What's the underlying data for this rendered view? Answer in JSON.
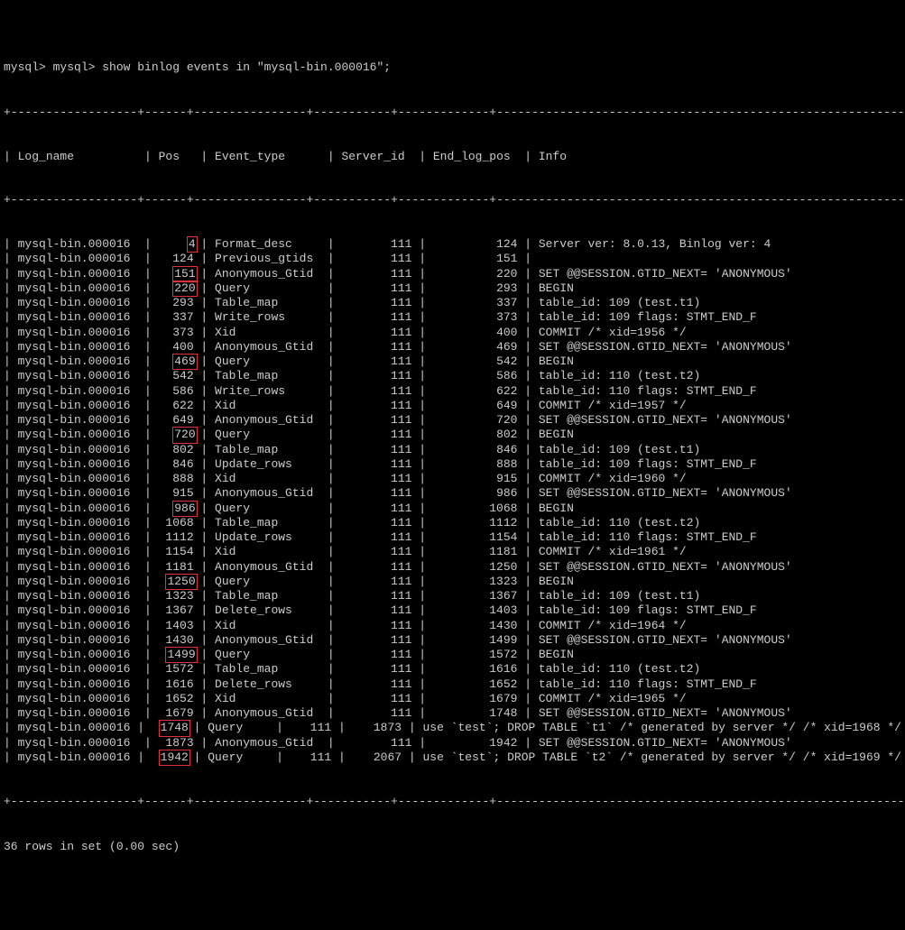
{
  "prompt": "mysql> mysql> show binlog events in \"mysql-bin.000016\";",
  "headers": {
    "log_name": "Log_name",
    "pos": "Pos",
    "event_type": "Event_type",
    "server_id": "Server_id",
    "end_log_pos": "End_log_pos",
    "info": "Info"
  },
  "border": "+------------------+------+----------------+-----------+-------------+----------------------------------------------------------------------+",
  "rows": [
    {
      "log": "mysql-bin.000016",
      "pos": "4",
      "hl": true,
      "ev": "Format_desc",
      "sid": "111",
      "end": "124",
      "info": "Server ver: 8.0.13, Binlog ver: 4"
    },
    {
      "log": "mysql-bin.000016",
      "pos": "124",
      "hl": false,
      "ev": "Previous_gtids",
      "sid": "111",
      "end": "151",
      "info": ""
    },
    {
      "log": "mysql-bin.000016",
      "pos": "151",
      "hl": true,
      "ev": "Anonymous_Gtid",
      "sid": "111",
      "end": "220",
      "info": "SET @@SESSION.GTID_NEXT= 'ANONYMOUS'"
    },
    {
      "log": "mysql-bin.000016",
      "pos": "220",
      "hl": true,
      "ev": "Query",
      "sid": "111",
      "end": "293",
      "info": "BEGIN"
    },
    {
      "log": "mysql-bin.000016",
      "pos": "293",
      "hl": false,
      "ev": "Table_map",
      "sid": "111",
      "end": "337",
      "info": "table_id: 109 (test.t1)"
    },
    {
      "log": "mysql-bin.000016",
      "pos": "337",
      "hl": false,
      "ev": "Write_rows",
      "sid": "111",
      "end": "373",
      "info": "table_id: 109 flags: STMT_END_F"
    },
    {
      "log": "mysql-bin.000016",
      "pos": "373",
      "hl": false,
      "ev": "Xid",
      "sid": "111",
      "end": "400",
      "info": "COMMIT /* xid=1956 */"
    },
    {
      "log": "mysql-bin.000016",
      "pos": "400",
      "hl": false,
      "ev": "Anonymous_Gtid",
      "sid": "111",
      "end": "469",
      "info": "SET @@SESSION.GTID_NEXT= 'ANONYMOUS'"
    },
    {
      "log": "mysql-bin.000016",
      "pos": "469",
      "hl": true,
      "ev": "Query",
      "sid": "111",
      "end": "542",
      "info": "BEGIN"
    },
    {
      "log": "mysql-bin.000016",
      "pos": "542",
      "hl": false,
      "ev": "Table_map",
      "sid": "111",
      "end": "586",
      "info": "table_id: 110 (test.t2)"
    },
    {
      "log": "mysql-bin.000016",
      "pos": "586",
      "hl": false,
      "ev": "Write_rows",
      "sid": "111",
      "end": "622",
      "info": "table_id: 110 flags: STMT_END_F"
    },
    {
      "log": "mysql-bin.000016",
      "pos": "622",
      "hl": false,
      "ev": "Xid",
      "sid": "111",
      "end": "649",
      "info": "COMMIT /* xid=1957 */"
    },
    {
      "log": "mysql-bin.000016",
      "pos": "649",
      "hl": false,
      "ev": "Anonymous_Gtid",
      "sid": "111",
      "end": "720",
      "info": "SET @@SESSION.GTID_NEXT= 'ANONYMOUS'"
    },
    {
      "log": "mysql-bin.000016",
      "pos": "720",
      "hl": true,
      "ev": "Query",
      "sid": "111",
      "end": "802",
      "info": "BEGIN"
    },
    {
      "log": "mysql-bin.000016",
      "pos": "802",
      "hl": false,
      "ev": "Table_map",
      "sid": "111",
      "end": "846",
      "info": "table_id: 109 (test.t1)"
    },
    {
      "log": "mysql-bin.000016",
      "pos": "846",
      "hl": false,
      "ev": "Update_rows",
      "sid": "111",
      "end": "888",
      "info": "table_id: 109 flags: STMT_END_F"
    },
    {
      "log": "mysql-bin.000016",
      "pos": "888",
      "hl": false,
      "ev": "Xid",
      "sid": "111",
      "end": "915",
      "info": "COMMIT /* xid=1960 */"
    },
    {
      "log": "mysql-bin.000016",
      "pos": "915",
      "hl": false,
      "ev": "Anonymous_Gtid",
      "sid": "111",
      "end": "986",
      "info": "SET @@SESSION.GTID_NEXT= 'ANONYMOUS'"
    },
    {
      "log": "mysql-bin.000016",
      "pos": "986",
      "hl": true,
      "ev": "Query",
      "sid": "111",
      "end": "1068",
      "info": "BEGIN"
    },
    {
      "log": "mysql-bin.000016",
      "pos": "1068",
      "hl": false,
      "ev": "Table_map",
      "sid": "111",
      "end": "1112",
      "info": "table_id: 110 (test.t2)"
    },
    {
      "log": "mysql-bin.000016",
      "pos": "1112",
      "hl": false,
      "ev": "Update_rows",
      "sid": "111",
      "end": "1154",
      "info": "table_id: 110 flags: STMT_END_F"
    },
    {
      "log": "mysql-bin.000016",
      "pos": "1154",
      "hl": false,
      "ev": "Xid",
      "sid": "111",
      "end": "1181",
      "info": "COMMIT /* xid=1961 */"
    },
    {
      "log": "mysql-bin.000016",
      "pos": "1181",
      "hl": false,
      "ev": "Anonymous_Gtid",
      "sid": "111",
      "end": "1250",
      "info": "SET @@SESSION.GTID_NEXT= 'ANONYMOUS'"
    },
    {
      "log": "mysql-bin.000016",
      "pos": "1250",
      "hl": true,
      "ev": "Query",
      "sid": "111",
      "end": "1323",
      "info": "BEGIN"
    },
    {
      "log": "mysql-bin.000016",
      "pos": "1323",
      "hl": false,
      "ev": "Table_map",
      "sid": "111",
      "end": "1367",
      "info": "table_id: 109 (test.t1)"
    },
    {
      "log": "mysql-bin.000016",
      "pos": "1367",
      "hl": false,
      "ev": "Delete_rows",
      "sid": "111",
      "end": "1403",
      "info": "table_id: 109 flags: STMT_END_F"
    },
    {
      "log": "mysql-bin.000016",
      "pos": "1403",
      "hl": false,
      "ev": "Xid",
      "sid": "111",
      "end": "1430",
      "info": "COMMIT /* xid=1964 */"
    },
    {
      "log": "mysql-bin.000016",
      "pos": "1430",
      "hl": false,
      "ev": "Anonymous_Gtid",
      "sid": "111",
      "end": "1499",
      "info": "SET @@SESSION.GTID_NEXT= 'ANONYMOUS'"
    },
    {
      "log": "mysql-bin.000016",
      "pos": "1499",
      "hl": true,
      "ev": "Query",
      "sid": "111",
      "end": "1572",
      "info": "BEGIN"
    },
    {
      "log": "mysql-bin.000016",
      "pos": "1572",
      "hl": false,
      "ev": "Table_map",
      "sid": "111",
      "end": "1616",
      "info": "table_id: 110 (test.t2)"
    },
    {
      "log": "mysql-bin.000016",
      "pos": "1616",
      "hl": false,
      "ev": "Delete_rows",
      "sid": "111",
      "end": "1652",
      "info": "table_id: 110 flags: STMT_END_F"
    },
    {
      "log": "mysql-bin.000016",
      "pos": "1652",
      "hl": false,
      "ev": "Xid",
      "sid": "111",
      "end": "1679",
      "info": "COMMIT /* xid=1965 */"
    },
    {
      "log": "mysql-bin.000016",
      "pos": "1679",
      "hl": false,
      "ev": "Anonymous_Gtid",
      "sid": "111",
      "end": "1748",
      "info": "SET @@SESSION.GTID_NEXT= 'ANONYMOUS'"
    },
    {
      "log": "mysql-bin.000016",
      "pos": "1748",
      "hl": true,
      "ev": "Query",
      "sid": "111",
      "end": "1873",
      "info": "use `test`; DROP TABLE `t1` /* generated by server */ /* xid=1968 */"
    },
    {
      "log": "mysql-bin.000016",
      "pos": "1873",
      "hl": false,
      "ev": "Anonymous_Gtid",
      "sid": "111",
      "end": "1942",
      "info": "SET @@SESSION.GTID_NEXT= 'ANONYMOUS'"
    },
    {
      "log": "mysql-bin.000016",
      "pos": "1942",
      "hl": true,
      "ev": "Query",
      "sid": "111",
      "end": "2067",
      "info": "use `test`; DROP TABLE `t2` /* generated by server */ /* xid=1969 */"
    }
  ],
  "footer": "36 rows in set (0.00 sec)"
}
